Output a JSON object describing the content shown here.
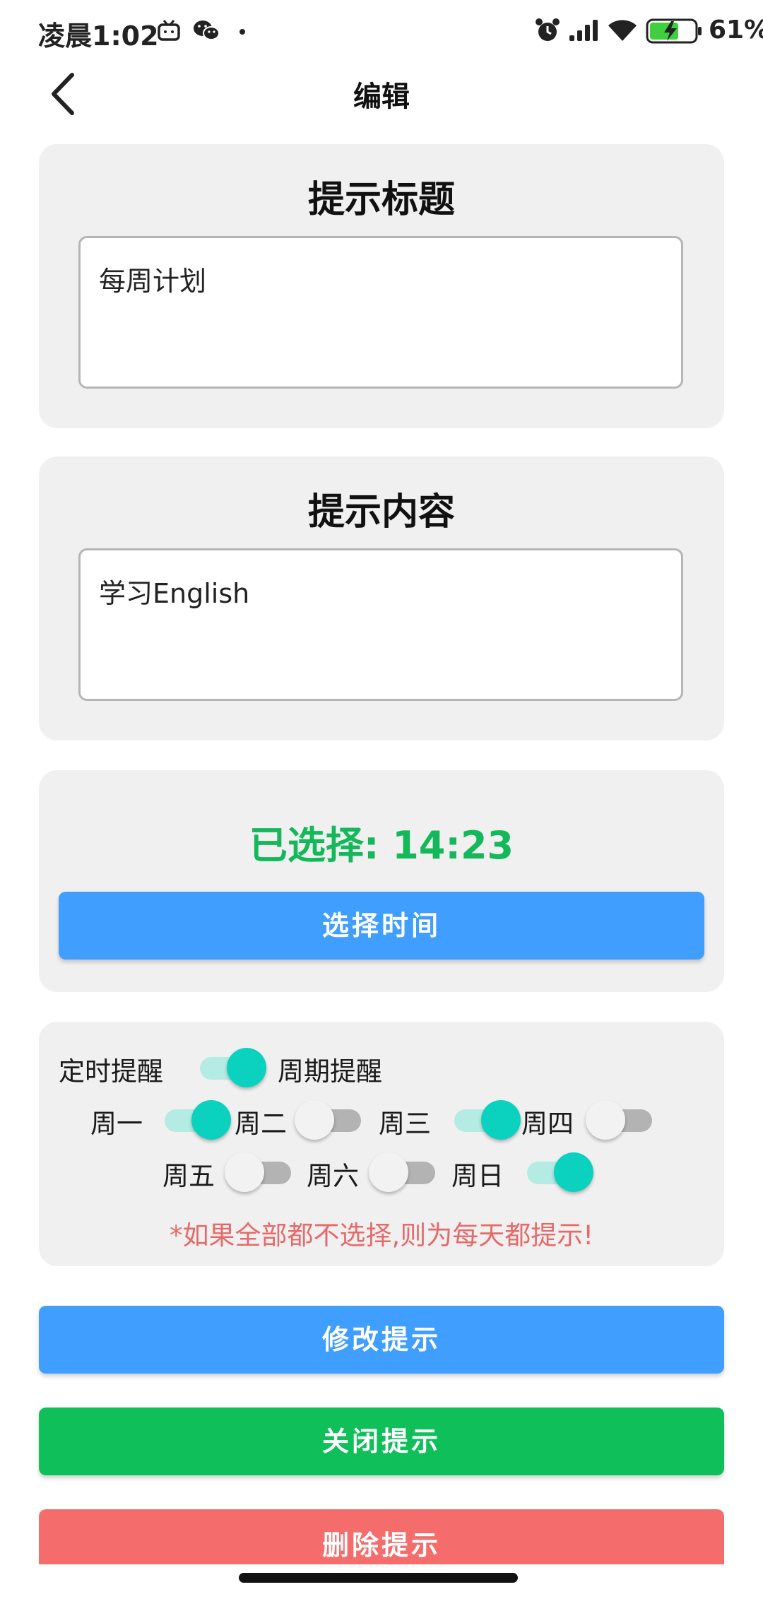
{
  "status_bar": {
    "time": "凌晨1:02",
    "battery": "61%",
    "icons": [
      "tv-icon",
      "wechat-icon",
      "alarm-icon",
      "signal-icon",
      "wifi-icon",
      "battery-charging-icon"
    ]
  },
  "header": {
    "title": "编辑",
    "back_icon": "chevron-left-icon"
  },
  "title_card": {
    "heading": "提示标题",
    "value": "每周计划"
  },
  "content_card": {
    "heading": "提示内容",
    "value": "学习English"
  },
  "time_card": {
    "selected": "已选择: 14:23",
    "select_button": "选择时间"
  },
  "repeat_card": {
    "mode_left": "定时提醒",
    "mode_right": "周期提醒",
    "mode_periodic": true,
    "days": [
      {
        "label": "周一",
        "on": true
      },
      {
        "label": "周二",
        "on": false
      },
      {
        "label": "周三",
        "on": true
      },
      {
        "label": "周四",
        "on": false
      },
      {
        "label": "周五",
        "on": false
      },
      {
        "label": "周六",
        "on": false
      },
      {
        "label": "周日",
        "on": true
      }
    ],
    "warning": "*如果全部都不选择,则为每天都提示!"
  },
  "actions": {
    "modify": "修改提示",
    "close": "关闭提示",
    "delete": "删除提示"
  },
  "colors": {
    "blue": "#409eff",
    "green": "#0fbf5a",
    "red": "#f56c6c",
    "toggle_on": "#0bd2bf",
    "card_bg": "#f0f0f0"
  }
}
